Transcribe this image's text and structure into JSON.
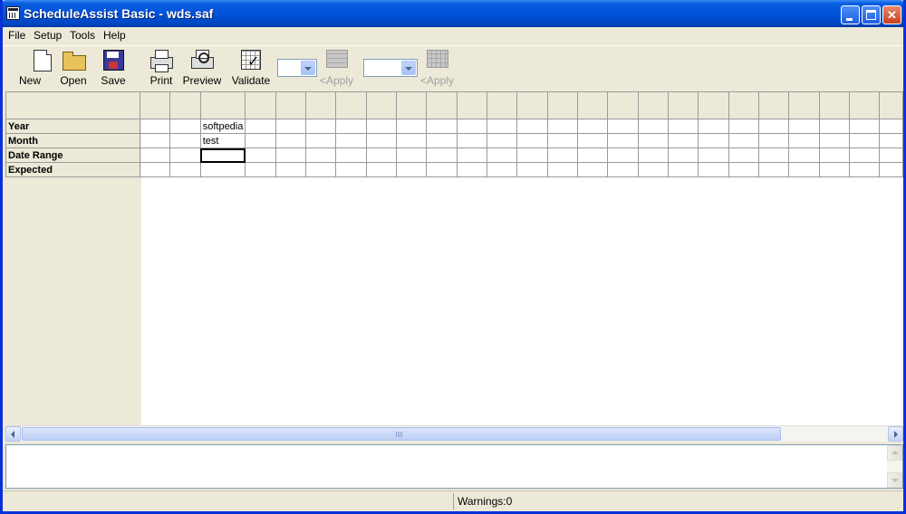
{
  "window": {
    "title": "ScheduleAssist Basic - wds.saf"
  },
  "menu": [
    "File",
    "Setup",
    "Tools",
    "Help"
  ],
  "toolbar": {
    "new": "New",
    "open": "Open",
    "save": "Save",
    "print": "Print",
    "preview": "Preview",
    "validate": "Validate",
    "apply1": "<Apply",
    "apply2": "<Apply"
  },
  "grid": {
    "row_labels": [
      "Year",
      "Month",
      "Date Range",
      "Expected"
    ],
    "cells": {
      "year_c3": "softpedia",
      "month_c3": "test"
    }
  },
  "status": {
    "warnings": "Warnings:0"
  },
  "icons": {
    "new": "new-document-icon",
    "open": "open-folder-icon",
    "save": "floppy-disk-icon",
    "print": "printer-icon",
    "preview": "print-preview-icon",
    "validate": "validate-check-icon"
  }
}
